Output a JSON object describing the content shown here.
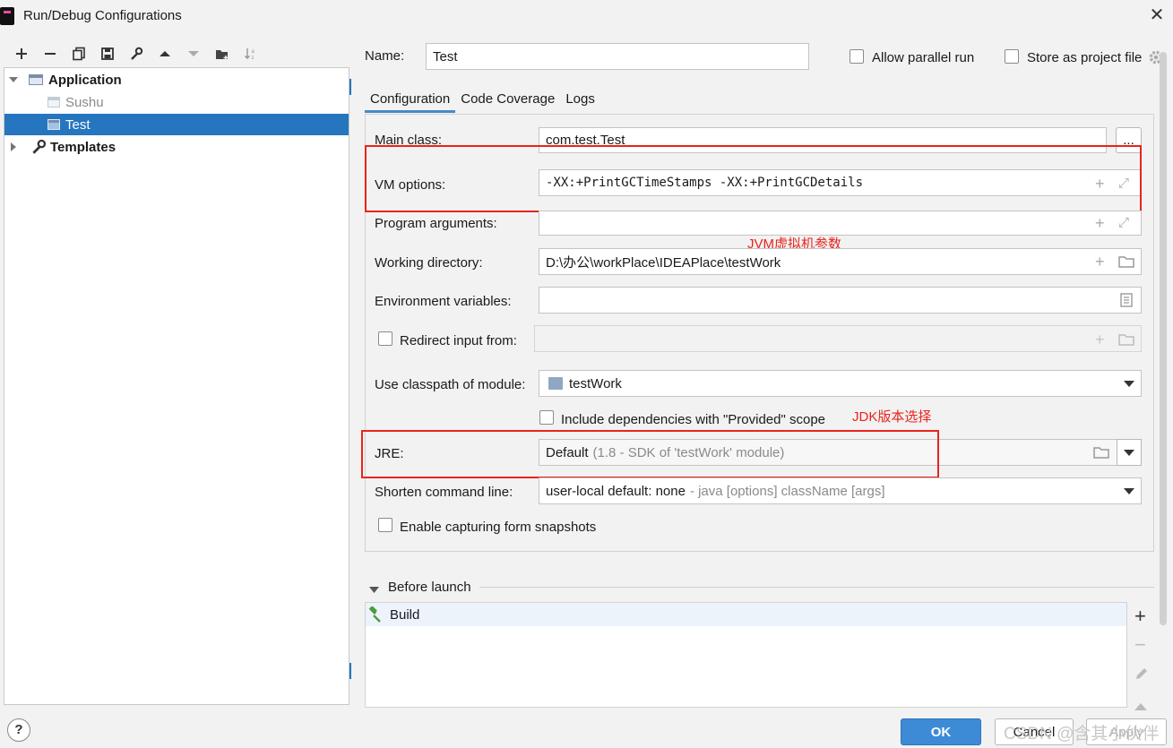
{
  "window": {
    "title": "Run/Debug Configurations"
  },
  "toolbar": {
    "icons": [
      "add-icon",
      "remove-icon",
      "copy-icon",
      "save-icon",
      "wrench-icon",
      "arrow-up-icon",
      "arrow-down-icon",
      "folder-add-icon",
      "sort-icon"
    ]
  },
  "tree": {
    "application": "Application",
    "items": [
      {
        "label": "Sushu"
      },
      {
        "label": "Test"
      }
    ],
    "templates": "Templates"
  },
  "name_field": {
    "label": "Name:",
    "value": "Test"
  },
  "options": {
    "allow_parallel": "Allow parallel run",
    "store_project": "Store as project file"
  },
  "tabs": [
    "Configuration",
    "Code Coverage",
    "Logs"
  ],
  "config": {
    "main_class": {
      "label": "Main class:",
      "value": "com.test.Test",
      "browse": "..."
    },
    "vm_options": {
      "label": "VM options:",
      "value": "-XX:+PrintGCTimeStamps -XX:+PrintGCDetails"
    },
    "program_args": {
      "label": "Program arguments:",
      "value": ""
    },
    "working_dir": {
      "label": "Working directory:",
      "value": "D:\\办公\\workPlace\\IDEAPlace\\testWork"
    },
    "env_vars": {
      "label": "Environment variables:",
      "value": ""
    },
    "redirect": {
      "label": "Redirect input from:",
      "value": ""
    },
    "classpath": {
      "label": "Use classpath of module:",
      "value": "testWork"
    },
    "include_deps": {
      "label": "Include dependencies with \"Provided\" scope"
    },
    "jre": {
      "label": "JRE:",
      "value": "Default",
      "hint": "(1.8 - SDK of 'testWork' module)"
    },
    "shorten": {
      "label": "Shorten command line:",
      "value": "user-local default: none",
      "hint": "- java [options] className [args]"
    },
    "snapshots": {
      "label": "Enable capturing form snapshots"
    }
  },
  "annotations": {
    "jvm": "JVM虚拟机参数",
    "jdk": "JDK版本选择"
  },
  "before_launch": {
    "title": "Before launch",
    "items": [
      "Build"
    ]
  },
  "buttons": {
    "ok": "OK",
    "cancel": "Cancel",
    "apply": "Apply",
    "help": "?"
  },
  "watermark": "CSDN @含其小伙伴",
  "colors": {
    "selection": "#2675bf",
    "annotation": "#e8241c",
    "ok_button": "#3d8bd7"
  }
}
